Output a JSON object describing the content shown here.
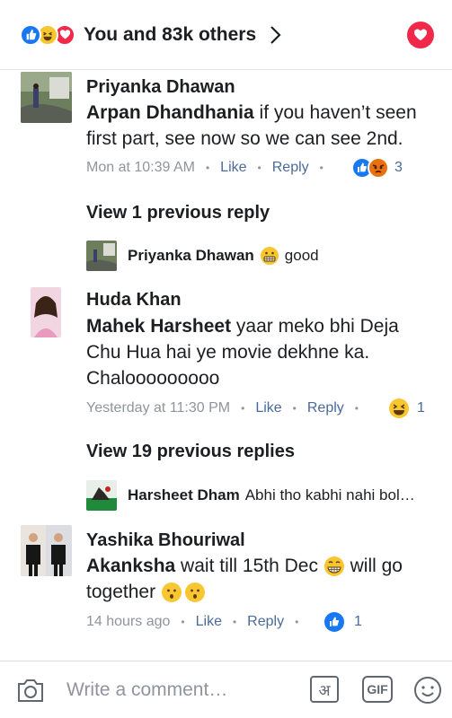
{
  "header": {
    "reactions_text": "You and 83k others",
    "reactions": [
      "like-icon",
      "haha-icon",
      "love-icon"
    ],
    "love_button": "love-icon"
  },
  "comments": [
    {
      "author": "Priyanka Dhawan",
      "mention": "Arpan Dhandhania",
      "text_line1": " if you haven’t seen",
      "text_line2": "first part, see now so we can see 2nd.",
      "time": "Mon at 10:39 AM",
      "like": "Like",
      "reply": "Reply",
      "reaction_count": "3",
      "reactions": [
        "like-icon",
        "angry-icon"
      ]
    },
    {
      "view_previous": "View 1 previous reply",
      "reply_author": "Priyanka Dhawan",
      "reply_text": "good",
      "reply_emoji": "grimace-emoji"
    },
    {
      "author": "Huda Khan",
      "mention": "Mahek Harsheet",
      "text_line1": " yaar meko bhi Deja",
      "text_line2": "Chu Hua hai ye movie dekhne ka.",
      "text_line3": "Chalooooooooo",
      "time": "Yesterday at 11:30 PM",
      "like": "Like",
      "reply": "Reply",
      "reaction_count": "1",
      "reactions": [
        "haha-icon"
      ]
    },
    {
      "view_previous": "View 19 previous replies",
      "reply_author": "Harsheet Dham",
      "reply_text": "Abhi tho kabhi nahi bol…"
    },
    {
      "author": "Yashika Bhouriwal",
      "mention": "Akanksha",
      "text_line1": " wait till 15th Dec",
      "text_line1_tail": " will go",
      "text_line2": "together",
      "time": "14 hours ago",
      "like": "Like",
      "reply": "Reply",
      "reaction_count": "1",
      "reactions": [
        "like-icon"
      ]
    }
  ],
  "composer": {
    "placeholder": "Write a comment…",
    "camera": "camera-icon",
    "translit": "अ",
    "gif": "GIF",
    "sticker": "sticker-icon"
  },
  "colors": {
    "like_blue": "#1877f2",
    "love_red": "#f0284a",
    "haha_yellow": "#f7c631",
    "meta_gray": "#90949c",
    "action_blue": "#4b6a9b"
  }
}
